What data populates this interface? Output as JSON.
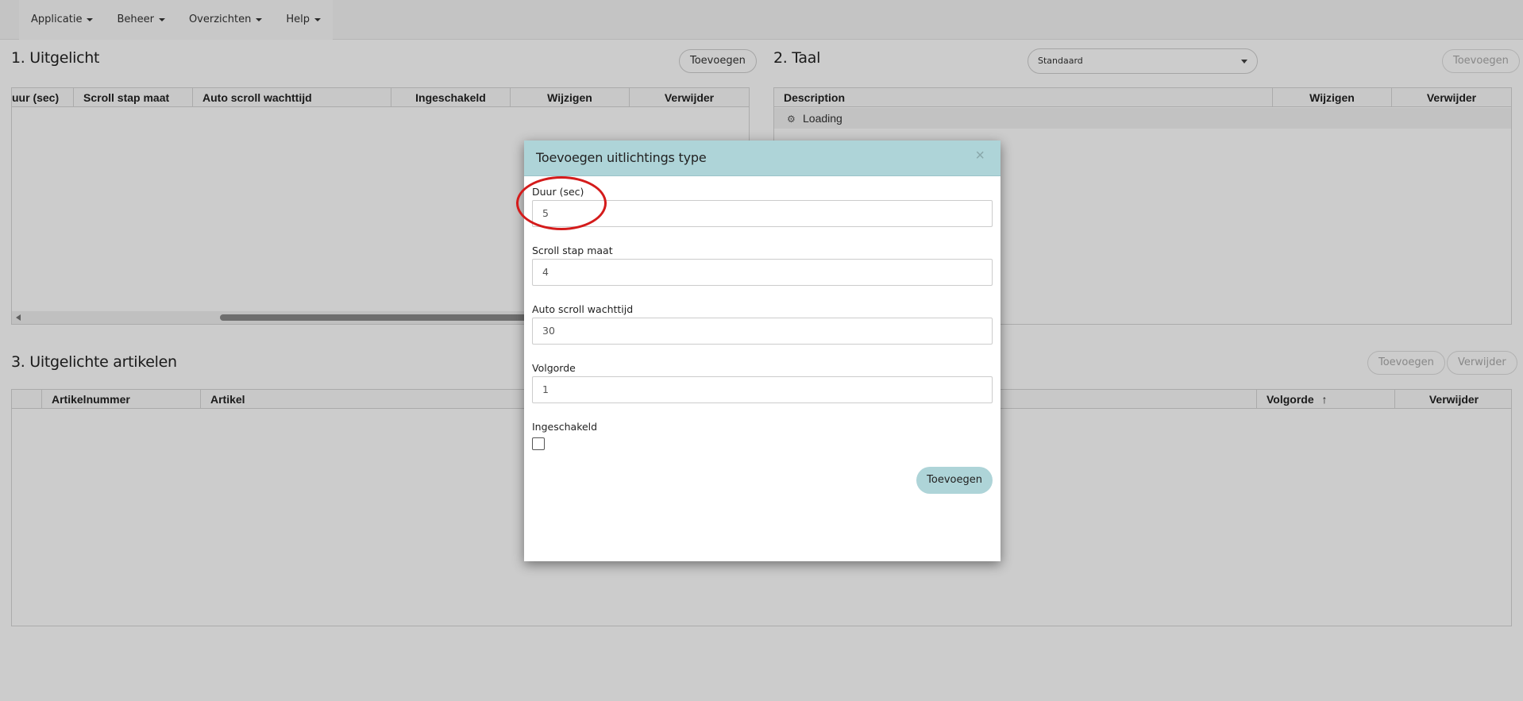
{
  "navbar": {
    "items": [
      {
        "label": "Applicatie"
      },
      {
        "label": "Beheer"
      },
      {
        "label": "Overzichten"
      },
      {
        "label": "Help"
      }
    ]
  },
  "section1": {
    "title": "1. Uitgelicht",
    "add_button": "Toevoegen",
    "columns": [
      "uur (sec)",
      "Scroll stap maat",
      "Auto scroll wachttijd",
      "Ingeschakeld",
      "Wijzigen",
      "Verwijder"
    ]
  },
  "section2": {
    "title": "2. Taal",
    "language_select": "Standaard",
    "add_button": "Toevoegen",
    "columns": [
      "Description",
      "Wijzigen",
      "Verwijder"
    ],
    "loading_text": "Loading"
  },
  "section3": {
    "title": "3. Uitgelichte artikelen",
    "add_button": "Toevoegen",
    "remove_button": "Verwijder",
    "columns": [
      "",
      "Artikelnummer",
      "Artikel",
      "Volgorde",
      "Verwijder"
    ]
  },
  "modal": {
    "title": "Toevoegen uitlichtings type",
    "close_symbol": "×",
    "fields": [
      {
        "label": "Duur (sec)",
        "value": "5"
      },
      {
        "label": "Scroll stap maat",
        "value": "4"
      },
      {
        "label": "Auto scroll wachttijd",
        "value": "30"
      },
      {
        "label": "Volgorde",
        "value": "1"
      }
    ],
    "checkbox_label": "Ingeschakeld",
    "checkbox_checked": false,
    "submit_label": "Toevoegen"
  },
  "icons": {
    "sort": "arrow-up-icon",
    "loading": "gear-icon"
  },
  "colors": {
    "modal_header": "#aed4d8",
    "annotation": "#d41b1b"
  }
}
